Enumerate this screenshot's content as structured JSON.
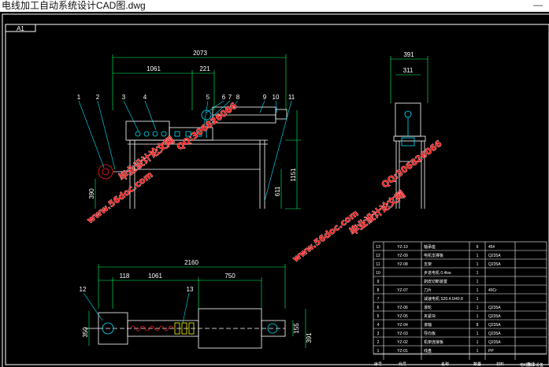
{
  "window": {
    "title": "电线加工自动系统设计CAD图.dwg",
    "minimize_glyph": "—"
  },
  "sheet": {
    "size_tag": "A1"
  },
  "dims": {
    "front": {
      "total": "2073",
      "left": "1061",
      "mid": "221",
      "height_frame": "1151",
      "height_inner": "611",
      "height_roll": "390"
    },
    "side": {
      "total": "391",
      "inner": "311"
    },
    "top": {
      "total": "2160",
      "a": "118",
      "b": "1061",
      "c": "750",
      "h_left": "350",
      "h_right1": "155",
      "h_right2": "391"
    }
  },
  "balloons": {
    "front": [
      "1",
      "2",
      "3",
      "4",
      "5",
      "6",
      "7",
      "8",
      "9",
      "10",
      "11"
    ],
    "top": [
      "12",
      "13"
    ]
  },
  "watermarks": [
    {
      "text": "毕业设计论文网"
    },
    {
      "text": "QQ:306826066"
    },
    {
      "text": "www.56doc.com"
    },
    {
      "text": "毕业设计论文网"
    },
    {
      "text": "QQ:306826066"
    },
    {
      "text": "www.56doc.com"
    }
  ],
  "bom": {
    "rows": [
      {
        "no": "13",
        "code": "YZ-10",
        "name": "轴承座",
        "qty": "6",
        "mat": "45#"
      },
      {
        "no": "12",
        "code": "YZ-09",
        "name": "电机支撑板",
        "qty": "1",
        "mat": "Q235A"
      },
      {
        "no": "11",
        "code": "YZ-08",
        "name": "支架",
        "qty": "1",
        "mat": "Q235A"
      },
      {
        "no": "10",
        "code": "",
        "name": "步进电机 0.4kw",
        "qty": "1",
        "mat": ""
      },
      {
        "no": "9",
        "code": "",
        "name": "剥皮切断装置",
        "qty": "1",
        "mat": ""
      },
      {
        "no": "8",
        "code": "YZ-07",
        "name": "刀片",
        "qty": "1",
        "mat": "40Cr"
      },
      {
        "no": "7",
        "code": "",
        "name": "减速电机 S20.4.0/40.8",
        "qty": "1",
        "mat": ""
      },
      {
        "no": "6",
        "code": "YZ-06",
        "name": "滚轮",
        "qty": "1",
        "mat": "Q235A"
      },
      {
        "no": "5",
        "code": "YZ-05",
        "name": "夹紧块",
        "qty": "1",
        "mat": "Q235A"
      },
      {
        "no": "4",
        "code": "YZ-04",
        "name": "滚轴",
        "qty": "8",
        "mat": "Q235A"
      },
      {
        "no": "3",
        "code": "YZ-03",
        "name": "导向板",
        "qty": "1",
        "mat": "Q235A"
      },
      {
        "no": "2",
        "code": "YZ-02",
        "name": "机架连接板",
        "qty": "1",
        "mat": "Q235A"
      },
      {
        "no": "1",
        "code": "YZ-01",
        "name": "线盘",
        "qty": "1",
        "mat": "PP"
      }
    ],
    "header": [
      "序号",
      "代号",
      "名称",
      "数量",
      "材料",
      "备注"
    ],
    "footer_note": "电线加工设备"
  },
  "colors": {
    "line": "#ffffff",
    "cyan": "#00e5ff",
    "green": "#00ff66",
    "yellow": "#ffff00",
    "red": "#ff2020",
    "magenta": "#ff00ff"
  }
}
